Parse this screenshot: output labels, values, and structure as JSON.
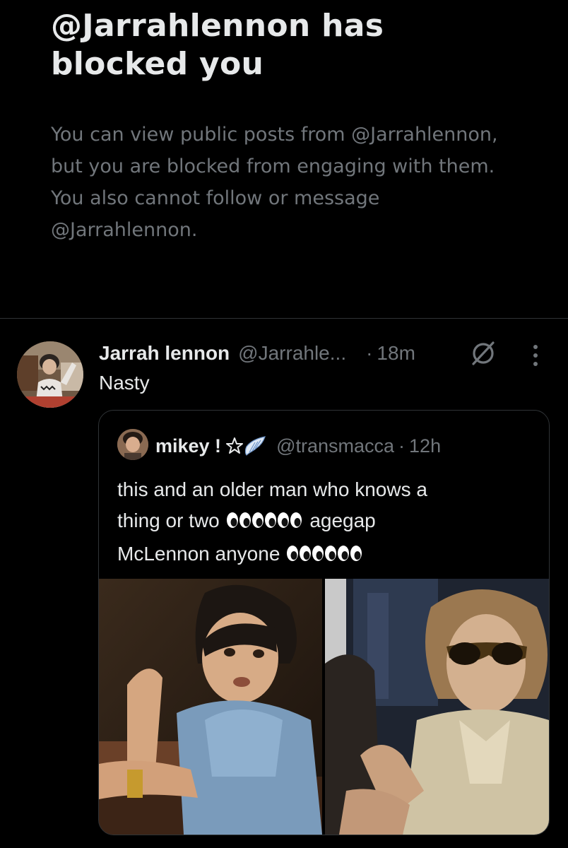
{
  "block_notice": {
    "title": "@Jarrahlennon has blocked you",
    "description": "You can view public posts from @Jarrahlennon, but you are blocked from engaging with them. You also cannot follow or message @Jarrahlennon."
  },
  "post": {
    "author_name": "Jarrah lennon",
    "author_handle": "@Jarrahle...",
    "separator": "·",
    "time": "18m",
    "text": "Nasty",
    "icons": [
      "blocked-icon",
      "more-icon"
    ]
  },
  "quote": {
    "author_name": "mikey !",
    "badges": [
      "star-icon",
      "wing-icon"
    ],
    "author_handle": "@transmacca",
    "separator": "·",
    "time": "12h",
    "text_line1": "this and an older man who knows a",
    "text_line2_a": "thing or two",
    "text_line2_b": "agegap",
    "text_line3": "McLennon anyone",
    "eyes_count": 6,
    "media": [
      "photo-left",
      "photo-right"
    ]
  },
  "colors": {
    "background": "#000000",
    "text_primary": "#e7e9ea",
    "text_secondary": "#71767b",
    "border": "#2f3336"
  }
}
